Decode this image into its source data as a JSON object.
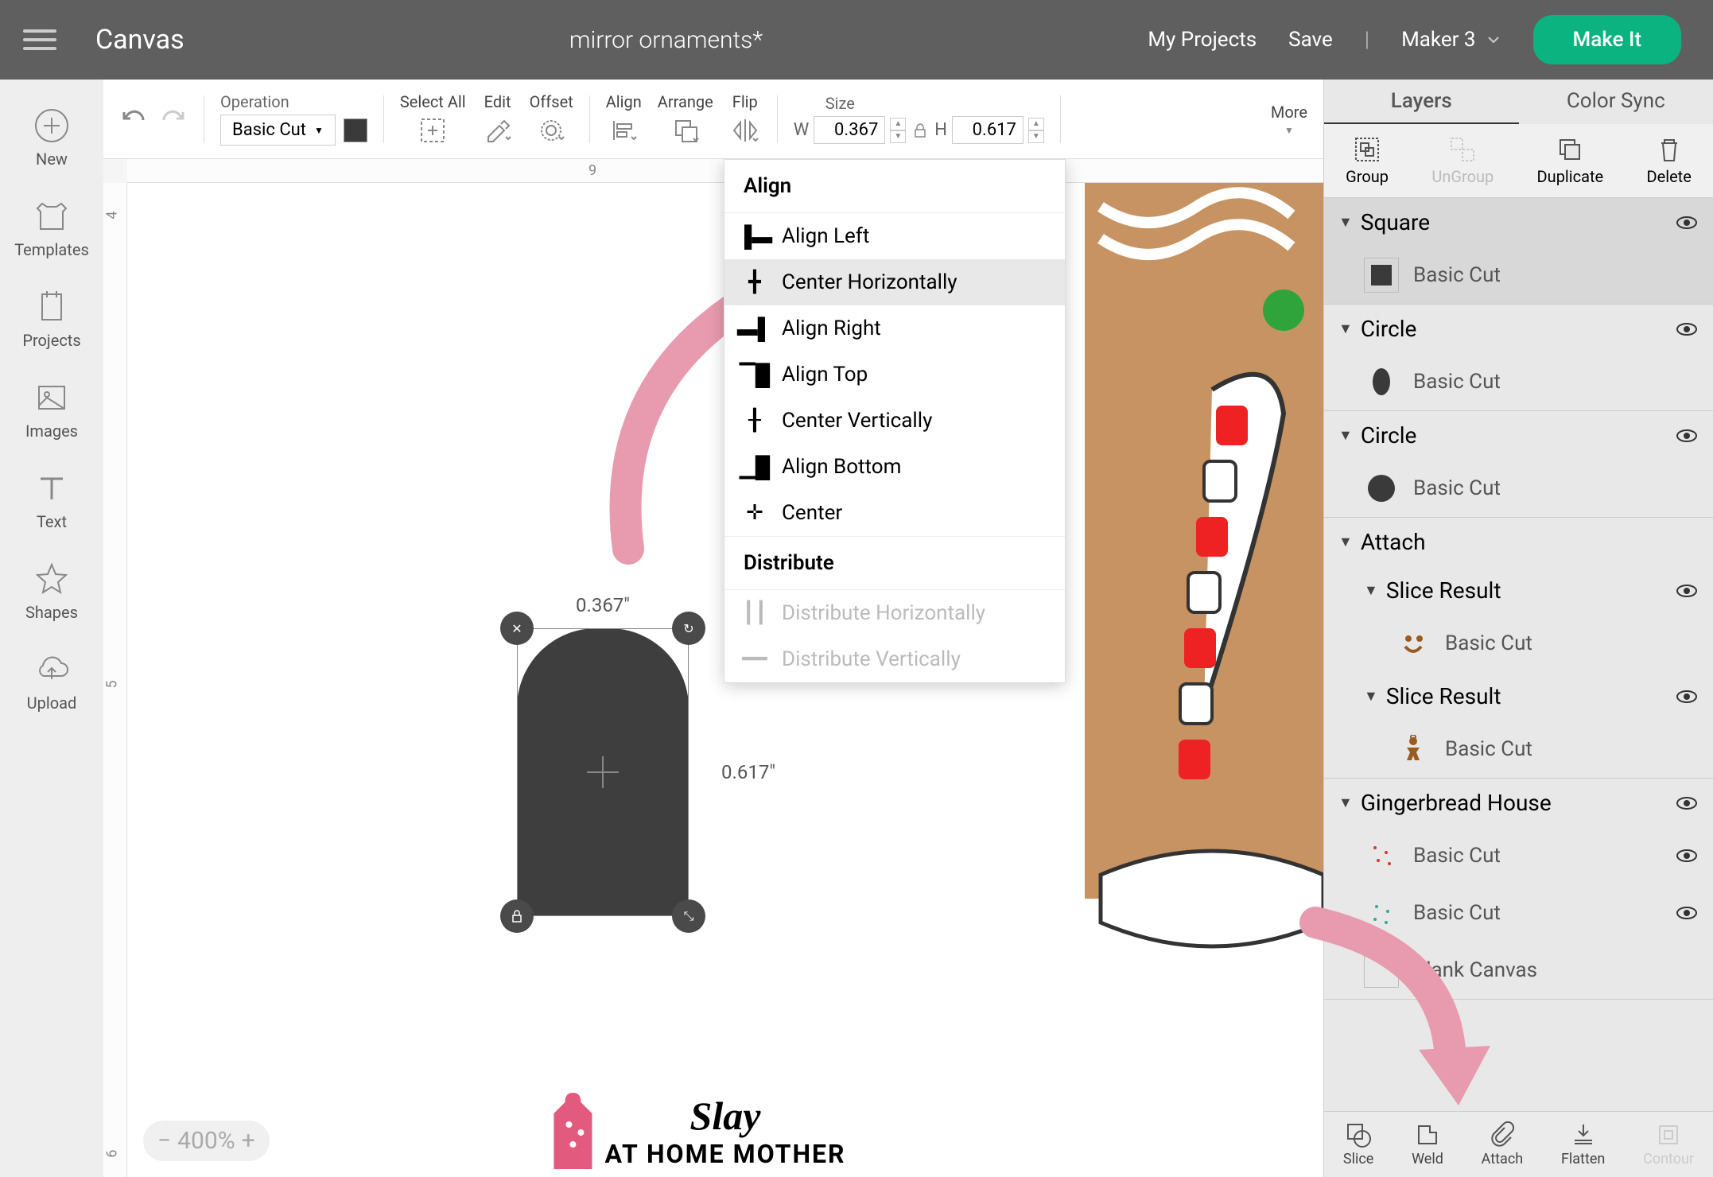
{
  "topbar": {
    "canvas": "Canvas",
    "project": "mirror ornaments*",
    "myProjects": "My Projects",
    "save": "Save",
    "divider": "|",
    "machine": "Maker 3",
    "makeIt": "Make It"
  },
  "leftbar": {
    "items": [
      {
        "label": "New",
        "icon": "plus"
      },
      {
        "label": "Templates",
        "icon": "shirt"
      },
      {
        "label": "Projects",
        "icon": "book"
      },
      {
        "label": "Images",
        "icon": "image"
      },
      {
        "label": "Text",
        "icon": "text"
      },
      {
        "label": "Shapes",
        "icon": "star"
      },
      {
        "label": "Upload",
        "icon": "cloud"
      }
    ]
  },
  "toolbar": {
    "operation": {
      "label": "Operation",
      "value": "Basic Cut"
    },
    "selectAll": "Select All",
    "edit": "Edit",
    "offset": "Offset",
    "align": "Align",
    "arrange": "Arrange",
    "flip": "Flip",
    "size": {
      "label": "Size",
      "w": "W",
      "wVal": "0.367",
      "h": "H",
      "hVal": "0.617"
    },
    "more": "More"
  },
  "ruler": {
    "h": [
      "9"
    ],
    "v": [
      "4",
      "5",
      "6"
    ]
  },
  "selection": {
    "width": "0.367\"",
    "height": "0.617\""
  },
  "alignMenu": {
    "header": "Align",
    "items": [
      {
        "label": "Align Left"
      },
      {
        "label": "Center Horizontally",
        "highlighted": true
      },
      {
        "label": "Align Right"
      },
      {
        "label": "Align Top"
      },
      {
        "label": "Center Vertically"
      },
      {
        "label": "Align Bottom"
      },
      {
        "label": "Center"
      }
    ],
    "distHeader": "Distribute",
    "distItems": [
      {
        "label": "Distribute Horizontally",
        "disabled": true
      },
      {
        "label": "Distribute Vertically",
        "disabled": true
      }
    ]
  },
  "rightPanel": {
    "tabs": {
      "layers": "Layers",
      "colorSync": "Color Sync"
    },
    "actions": {
      "group": "Group",
      "ungroup": "UnGroup",
      "duplicate": "Duplicate",
      "delete": "Delete"
    },
    "layers": [
      {
        "name": "Square",
        "children": [
          {
            "op": "Basic Cut",
            "color": "#3a3a3a",
            "shape": "square"
          }
        ]
      },
      {
        "name": "Circle",
        "children": [
          {
            "op": "Basic Cut",
            "color": "#3a3a3a",
            "shape": "ellipse"
          }
        ]
      },
      {
        "name": "Circle",
        "children": [
          {
            "op": "Basic Cut",
            "color": "#3a3a3a",
            "shape": "circle"
          }
        ]
      },
      {
        "name": "Attach",
        "children": [
          {
            "name": "Slice Result",
            "op": "Basic Cut",
            "icon": "smiley",
            "nested": true
          },
          {
            "name": "Slice Result",
            "op": "Basic Cut",
            "icon": "gingerbread",
            "nested": true
          }
        ]
      },
      {
        "name": "Gingerbread House",
        "children": [
          {
            "op": "Basic Cut",
            "icon": "sparkle-red"
          },
          {
            "op": "Basic Cut",
            "icon": "sparkle-green"
          },
          {
            "op": "Blank Canvas",
            "icon": "blank"
          }
        ]
      }
    ],
    "bottom": {
      "slice": "Slice",
      "weld": "Weld",
      "attach": "Attach",
      "flatten": "Flatten",
      "contour": "Contour"
    }
  },
  "zoom": "400%",
  "watermark": {
    "title": "Slay",
    "sub": "AT HOME MOTHER"
  }
}
